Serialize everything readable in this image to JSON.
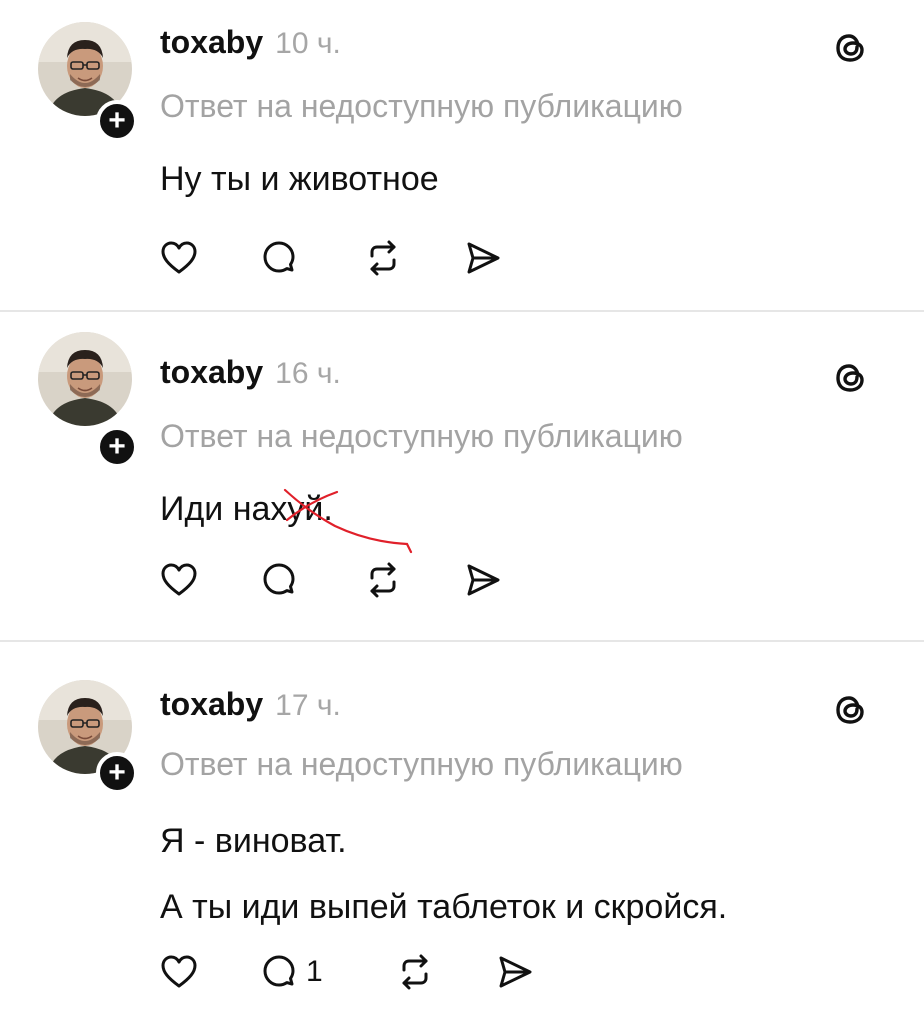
{
  "posts": [
    {
      "username": "toxaby",
      "time": "10 ч.",
      "reply_note": "Ответ на недоступную публикацию",
      "body_lines": [
        "Ну ты и животное"
      ],
      "reply_count": ""
    },
    {
      "username": "toxaby",
      "time": "16 ч.",
      "reply_note": "Ответ на недоступную публикацию",
      "body_visible": "Иди нах",
      "body_struck": "уй.",
      "reply_count": ""
    },
    {
      "username": "toxaby",
      "time": "17 ч.",
      "reply_note": "Ответ на недоступную публикацию",
      "body_lines": [
        "Я - виноват.",
        "А ты иди выпей таблеток и скройся."
      ],
      "reply_count": "1"
    }
  ],
  "icons": {
    "follow": "+",
    "threads_logo": "threads-logo-icon",
    "like": "heart-icon",
    "reply": "comment-bubble-icon",
    "repost": "repost-icon",
    "share": "send-icon"
  },
  "colors": {
    "text": "#111111",
    "muted": "#a3a3a3",
    "divider": "#e6e6e6",
    "scribble": "#e0202a"
  }
}
